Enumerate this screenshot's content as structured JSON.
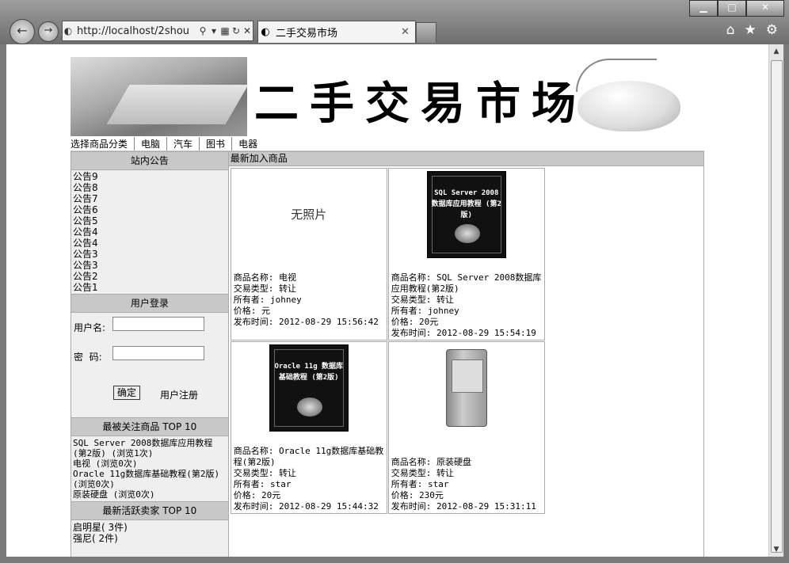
{
  "browser": {
    "url": "http://localhost/2shou",
    "tab_title": "二手交易市场",
    "window_buttons": {
      "minimize": "▁",
      "maximize": "□",
      "close": "✕"
    }
  },
  "site": {
    "banner_title": "二手交易市场",
    "categories_label": "选择商品分类",
    "categories": [
      "电脑",
      "汽车",
      "图书",
      "电器"
    ]
  },
  "sidebar": {
    "notice_header": "站内公告",
    "notices": [
      "公告9",
      "公告8",
      "公告7",
      "公告6",
      "公告5",
      "公告4",
      "公告4",
      "公告3",
      "公告3",
      "公告2",
      "公告1"
    ],
    "login_header": "用户登录",
    "username_label": "用户名:",
    "password_label": "密  码:",
    "confirm_label": "确定",
    "register_label": "用户注册",
    "top_items_header": "最被关注商品 TOP 10",
    "top_items": [
      "SQL Server 2008数据库应用教程(第2版) (浏览1次)",
      "电视 (浏览0次)",
      "Oracle 11g数据库基础教程(第2版) (浏览0次)",
      "原装硬盘 (浏览0次)"
    ],
    "top_sellers_header": "最新活跃卖家 TOP 10",
    "top_sellers": [
      "启明星( 3件)",
      "强尼( 2件)"
    ]
  },
  "main": {
    "header": "最新加入商品",
    "no_photo": "无照片",
    "items": [
      {
        "name": "商品名称: 电视",
        "trade": "交易类型:  转让",
        "owner": "所有者: johney",
        "price": "价格: 元",
        "time": "发布时间: 2012-08-29 15:56:42",
        "image": "none"
      },
      {
        "name": "商品名称: SQL Server 2008数据库应用教程(第2版)",
        "trade": "交易类型:  转让",
        "owner": "所有者: johney",
        "price": "价格: 20元",
        "time": "发布时间: 2012-08-29 15:54:19",
        "image": "book",
        "cover_text": "SQL Server 2008 数据库应用教程 (第2版)"
      },
      {
        "name": "商品名称: Oracle 11g数据库基础教程(第2版)",
        "trade": "交易类型:  转让",
        "owner": "所有者: star",
        "price": "价格: 20元",
        "time": "发布时间: 2012-08-29 15:44:32",
        "image": "book",
        "cover_text": "Oracle 11g 数据库基础教程 (第2版)"
      },
      {
        "name": "商品名称: 原装硬盘",
        "trade": "交易类型:  转让",
        "owner": "所有者: star",
        "price": "价格: 230元",
        "time": "发布时间: 2012-08-29 15:31:11",
        "image": "hdd"
      }
    ]
  }
}
